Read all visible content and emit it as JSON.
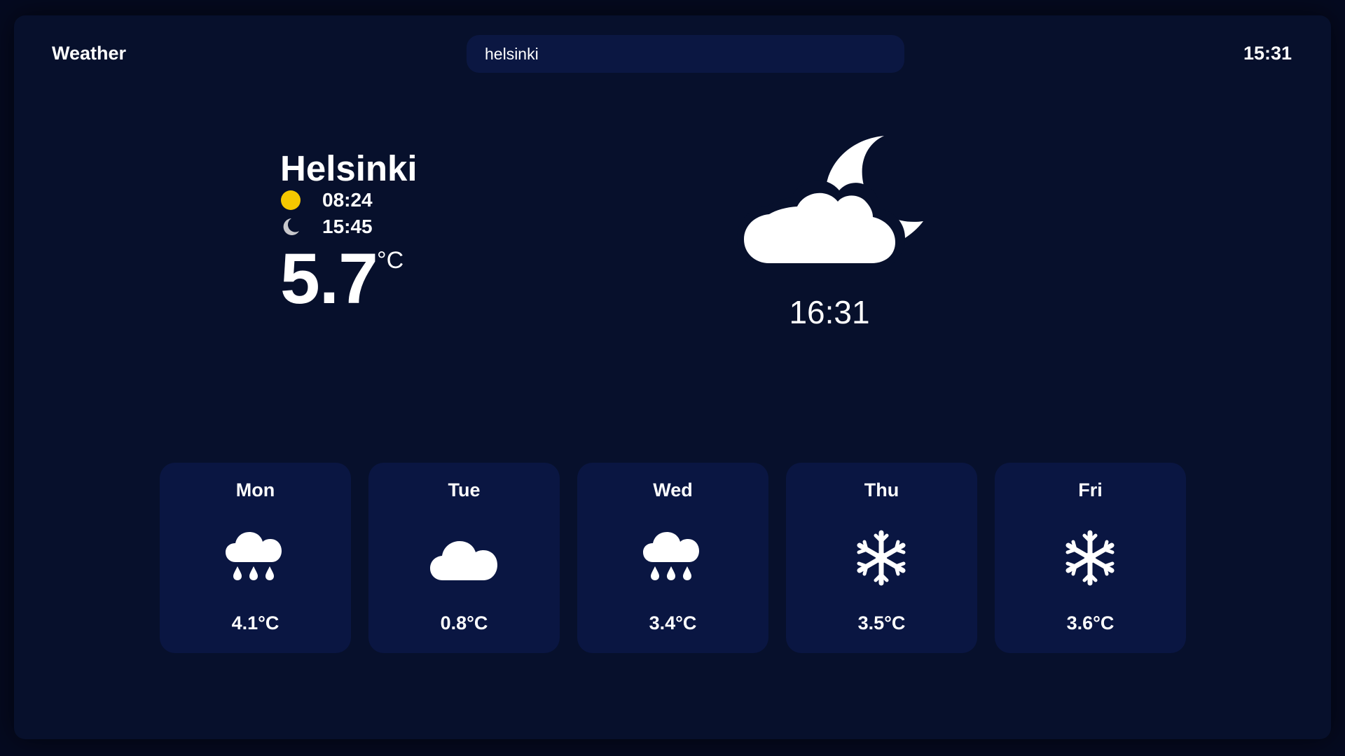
{
  "header": {
    "app_title": "Weather",
    "search_value": "helsinki",
    "clock": "15:31"
  },
  "current": {
    "city": "Helsinki",
    "sunrise": "08:24",
    "sunset": "15:45",
    "temperature": "5.7",
    "unit": "°C",
    "condition_icon": "cloud-moon-icon",
    "hero_time": "16:31"
  },
  "colors": {
    "background": "#07102c",
    "card": "#0a1642",
    "sun": "#f5c800",
    "moon": "#c8c8cc"
  },
  "forecast": [
    {
      "day": "Mon",
      "icon": "cloud-rain-icon",
      "temp": "4.1°C"
    },
    {
      "day": "Tue",
      "icon": "cloud-icon",
      "temp": "0.8°C"
    },
    {
      "day": "Wed",
      "icon": "cloud-rain-icon",
      "temp": "3.4°C"
    },
    {
      "day": "Thu",
      "icon": "snowflake-icon",
      "temp": "3.5°C"
    },
    {
      "day": "Fri",
      "icon": "snowflake-icon",
      "temp": "3.6°C"
    }
  ]
}
